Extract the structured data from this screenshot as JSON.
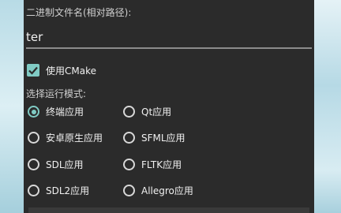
{
  "dialog": {
    "filename_label": "二进制文件名(相对路径):",
    "filename_value": "ter",
    "use_cmake_label": "使用CMake",
    "use_cmake_checked": true,
    "run_mode_label": "选择运行模式:",
    "run_modes": [
      {
        "label": "终端应用",
        "checked": true
      },
      {
        "label": "Qt应用",
        "checked": false
      },
      {
        "label": "安卓原生应用",
        "checked": false
      },
      {
        "label": "SFML应用",
        "checked": false
      },
      {
        "label": "SDL应用",
        "checked": false
      },
      {
        "label": "FLTK应用",
        "checked": false
      },
      {
        "label": "SDL2应用",
        "checked": false
      },
      {
        "label": "Allegro应用",
        "checked": false
      }
    ]
  },
  "colors": {
    "accent": "#80cbc4",
    "dialog_bg": "#2b2b2b",
    "text": "#f0f0f0"
  },
  "icons": {
    "checkbox": "check-icon"
  }
}
